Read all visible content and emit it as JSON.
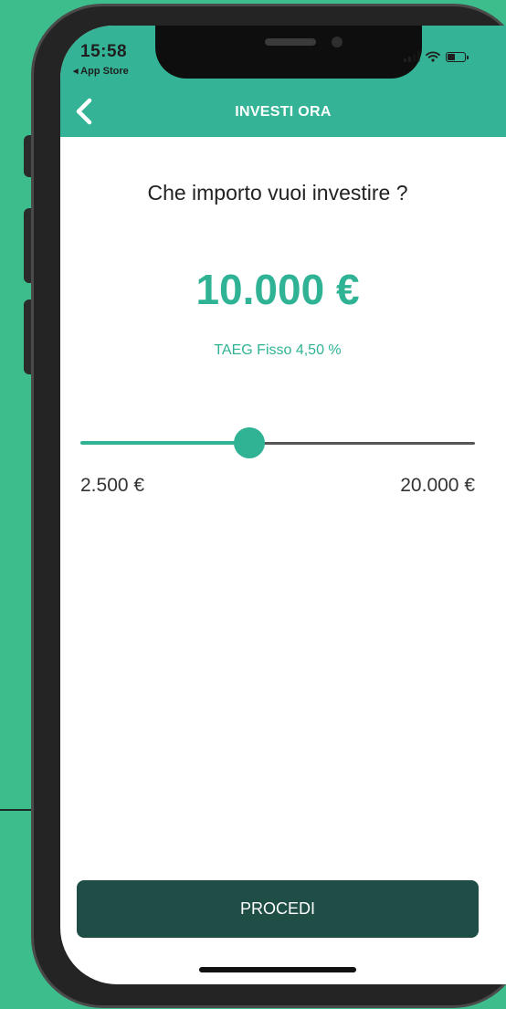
{
  "theme": {
    "accent": "#2fb394",
    "header": "#34b396",
    "button": "#1f4e47",
    "background": "#3dbd8c"
  },
  "status_bar": {
    "time": "15:58",
    "back_app": "◂ App Store"
  },
  "nav": {
    "title": "INVESTI ORA",
    "back_icon": "chevron-left-icon"
  },
  "content": {
    "question": "Che importo vuoi investire ?",
    "amount": "10.000 €",
    "rate": "TAEG Fisso 4,50 %"
  },
  "slider": {
    "min_label": "2.500 €",
    "max_label": "20.000 €",
    "min": 2500,
    "max": 20000,
    "value": 10000
  },
  "actions": {
    "proceed": "PROCEDI"
  }
}
